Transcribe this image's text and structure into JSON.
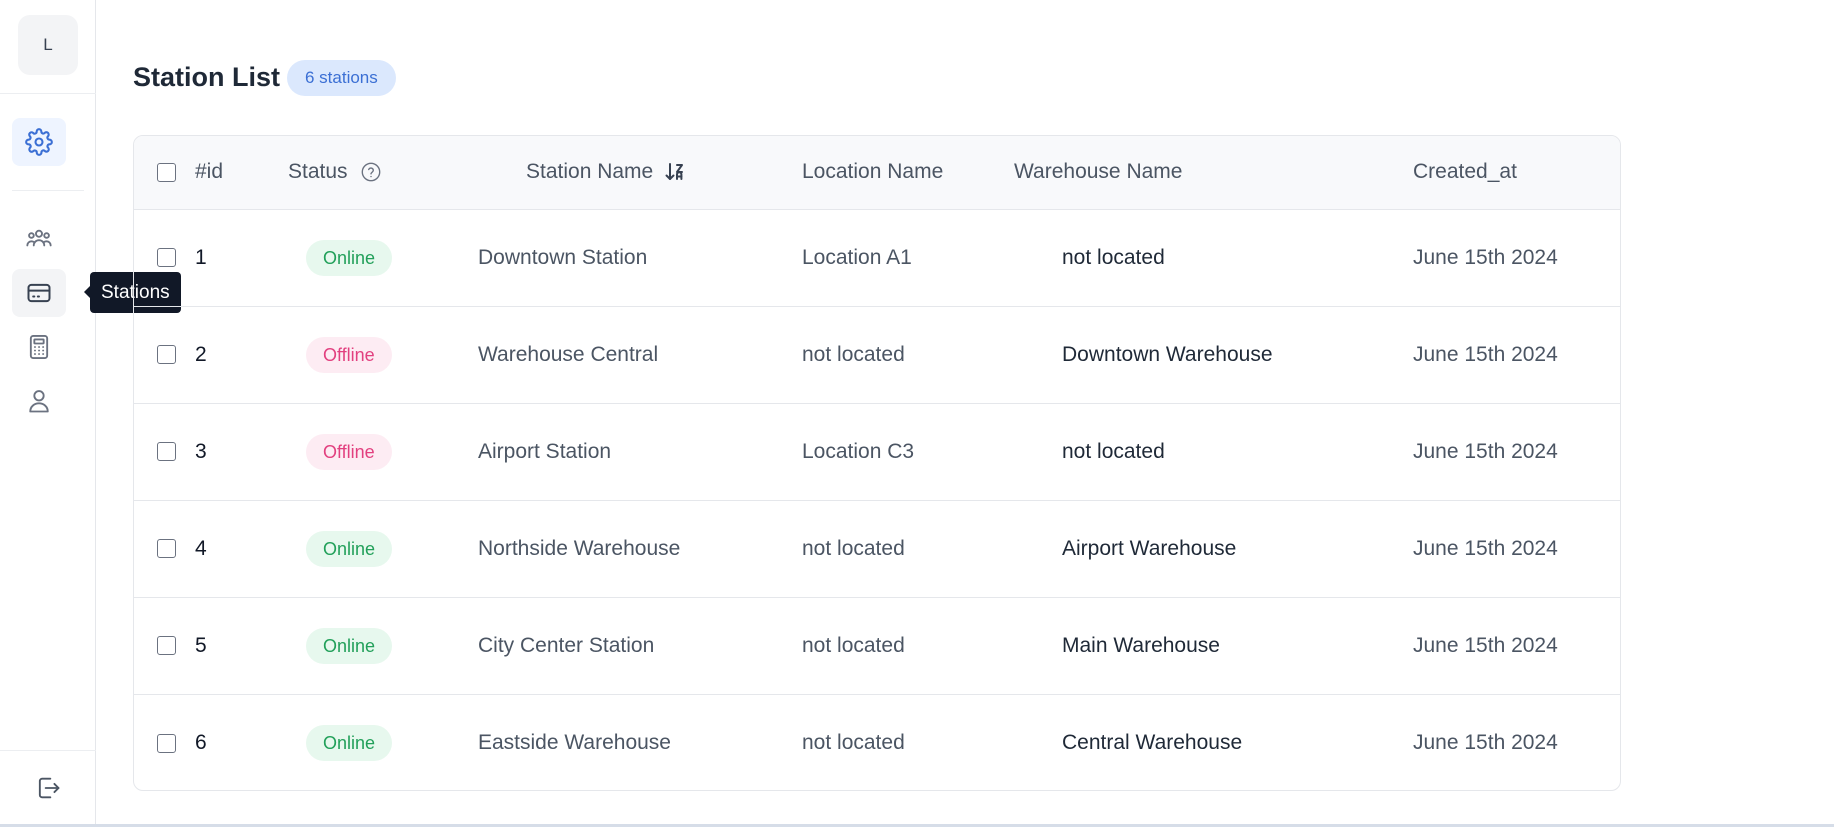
{
  "sidebar": {
    "avatar_initial": "L",
    "tooltip": "Stations",
    "nav": [
      {
        "icon": "gear-icon",
        "active": true
      },
      {
        "icon": "team-icon"
      },
      {
        "icon": "card-icon",
        "hover": true
      },
      {
        "icon": "calculator-icon"
      },
      {
        "icon": "user-icon"
      }
    ],
    "logout_icon": "logout-icon"
  },
  "header": {
    "title": "Station List",
    "count_badge": "6 stations"
  },
  "table": {
    "columns": {
      "id": "#id",
      "status": "Status",
      "station_name": "Station Name",
      "location_name": "Location Name",
      "warehouse_name": "Warehouse Name",
      "created_at": "Created_at"
    },
    "rows": [
      {
        "id": "1",
        "status": "Online",
        "station_name": "Downtown Station",
        "location_name": "Location A1",
        "warehouse_name": "not located",
        "created_at": "June 15th 2024"
      },
      {
        "id": "2",
        "status": "Offline",
        "station_name": "Warehouse Central",
        "location_name": "not located",
        "warehouse_name": "Downtown Warehouse",
        "created_at": "June 15th 2024"
      },
      {
        "id": "3",
        "status": "Offline",
        "station_name": "Airport Station",
        "location_name": "Location C3",
        "warehouse_name": "not located",
        "created_at": "June 15th 2024"
      },
      {
        "id": "4",
        "status": "Online",
        "station_name": "Northside Warehouse",
        "location_name": "not located",
        "warehouse_name": "Airport Warehouse",
        "created_at": "June 15th 2024"
      },
      {
        "id": "5",
        "status": "Online",
        "station_name": "City Center Station",
        "location_name": "not located",
        "warehouse_name": "Main Warehouse",
        "created_at": "June 15th 2024"
      },
      {
        "id": "6",
        "status": "Online",
        "station_name": "Eastside Warehouse",
        "location_name": "not located",
        "warehouse_name": "Central Warehouse",
        "created_at": "June 15th 2024"
      }
    ]
  },
  "colors": {
    "accent": "#3b6fd4",
    "online_bg": "#e7f8ee",
    "online_text": "#22a05a",
    "offline_bg": "#fdecf3",
    "offline_text": "#e2407f",
    "tooltip_bg": "#111827"
  }
}
